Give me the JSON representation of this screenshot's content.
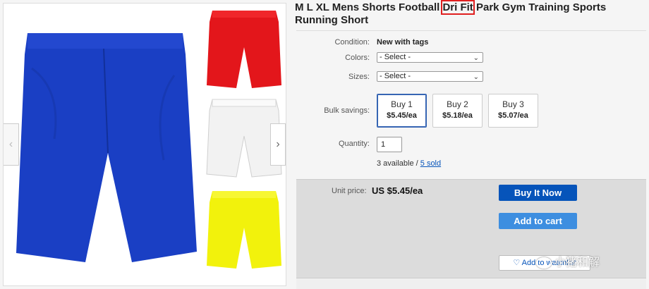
{
  "product": {
    "title_before": "M L XL Mens Shorts Football ",
    "title_highlight": "Dri Fit",
    "title_after": " Park Gym Training Sports Running Short"
  },
  "colors": {
    "accent": "#0654ba",
    "cart": "#3d8ee0",
    "highlight": "#e02020"
  },
  "gallery": {
    "main_image": "blue-shorts",
    "thumbnails": [
      "red-shorts",
      "white-shorts",
      "yellow-shorts"
    ],
    "prev_label": "‹",
    "next_label": "›"
  },
  "details": {
    "condition_label": "Condition:",
    "condition_value": "New with tags",
    "colors_label": "Colors:",
    "colors_select": "- Select -",
    "sizes_label": "Sizes:",
    "sizes_select": "- Select -",
    "bulk_label": "Bulk savings:",
    "bulk": [
      {
        "name": "Buy 1",
        "price": "$5.45/ea",
        "selected": true
      },
      {
        "name": "Buy 2",
        "price": "$5.18/ea",
        "selected": false
      },
      {
        "name": "Buy 3",
        "price": "$5.07/ea",
        "selected": false
      }
    ],
    "quantity_label": "Quantity:",
    "quantity_value": "1",
    "available_text": "3 available / ",
    "sold_link": "5 sold"
  },
  "buybox": {
    "unit_price_label": "Unit price:",
    "unit_price": "US $5.45/ea",
    "buy_now": "Buy It Now",
    "add_to_cart": "Add to cart",
    "watchlist": "Add to watchlist"
  },
  "watermark": {
    "text": "小猪和解"
  }
}
